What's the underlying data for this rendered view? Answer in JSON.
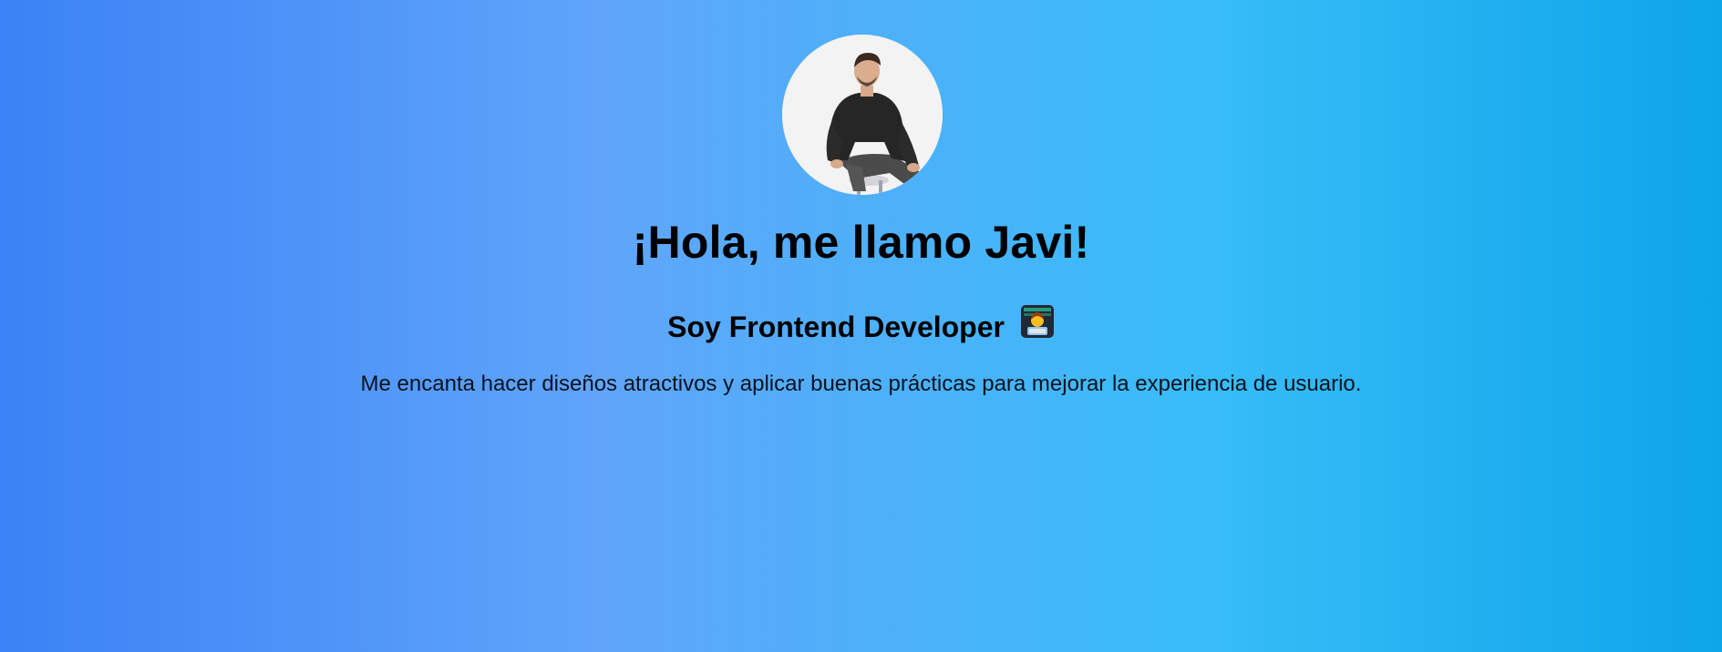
{
  "hero": {
    "avatar_icon": "person-photo",
    "title": "¡Hola, me llamo Javi!",
    "subtitle": "Soy Frontend Developer",
    "subtitle_emoji_icon": "technologist-emoji",
    "description": "Me encanta hacer diseños atractivos y aplicar buenas prácticas para mejorar la experiencia de usuario."
  },
  "colors": {
    "background_start": "#3b82f6",
    "background_mid": "#60a5fa",
    "background_light": "#38bdf8",
    "background_end": "#0ea5e9",
    "text": "#000000"
  }
}
